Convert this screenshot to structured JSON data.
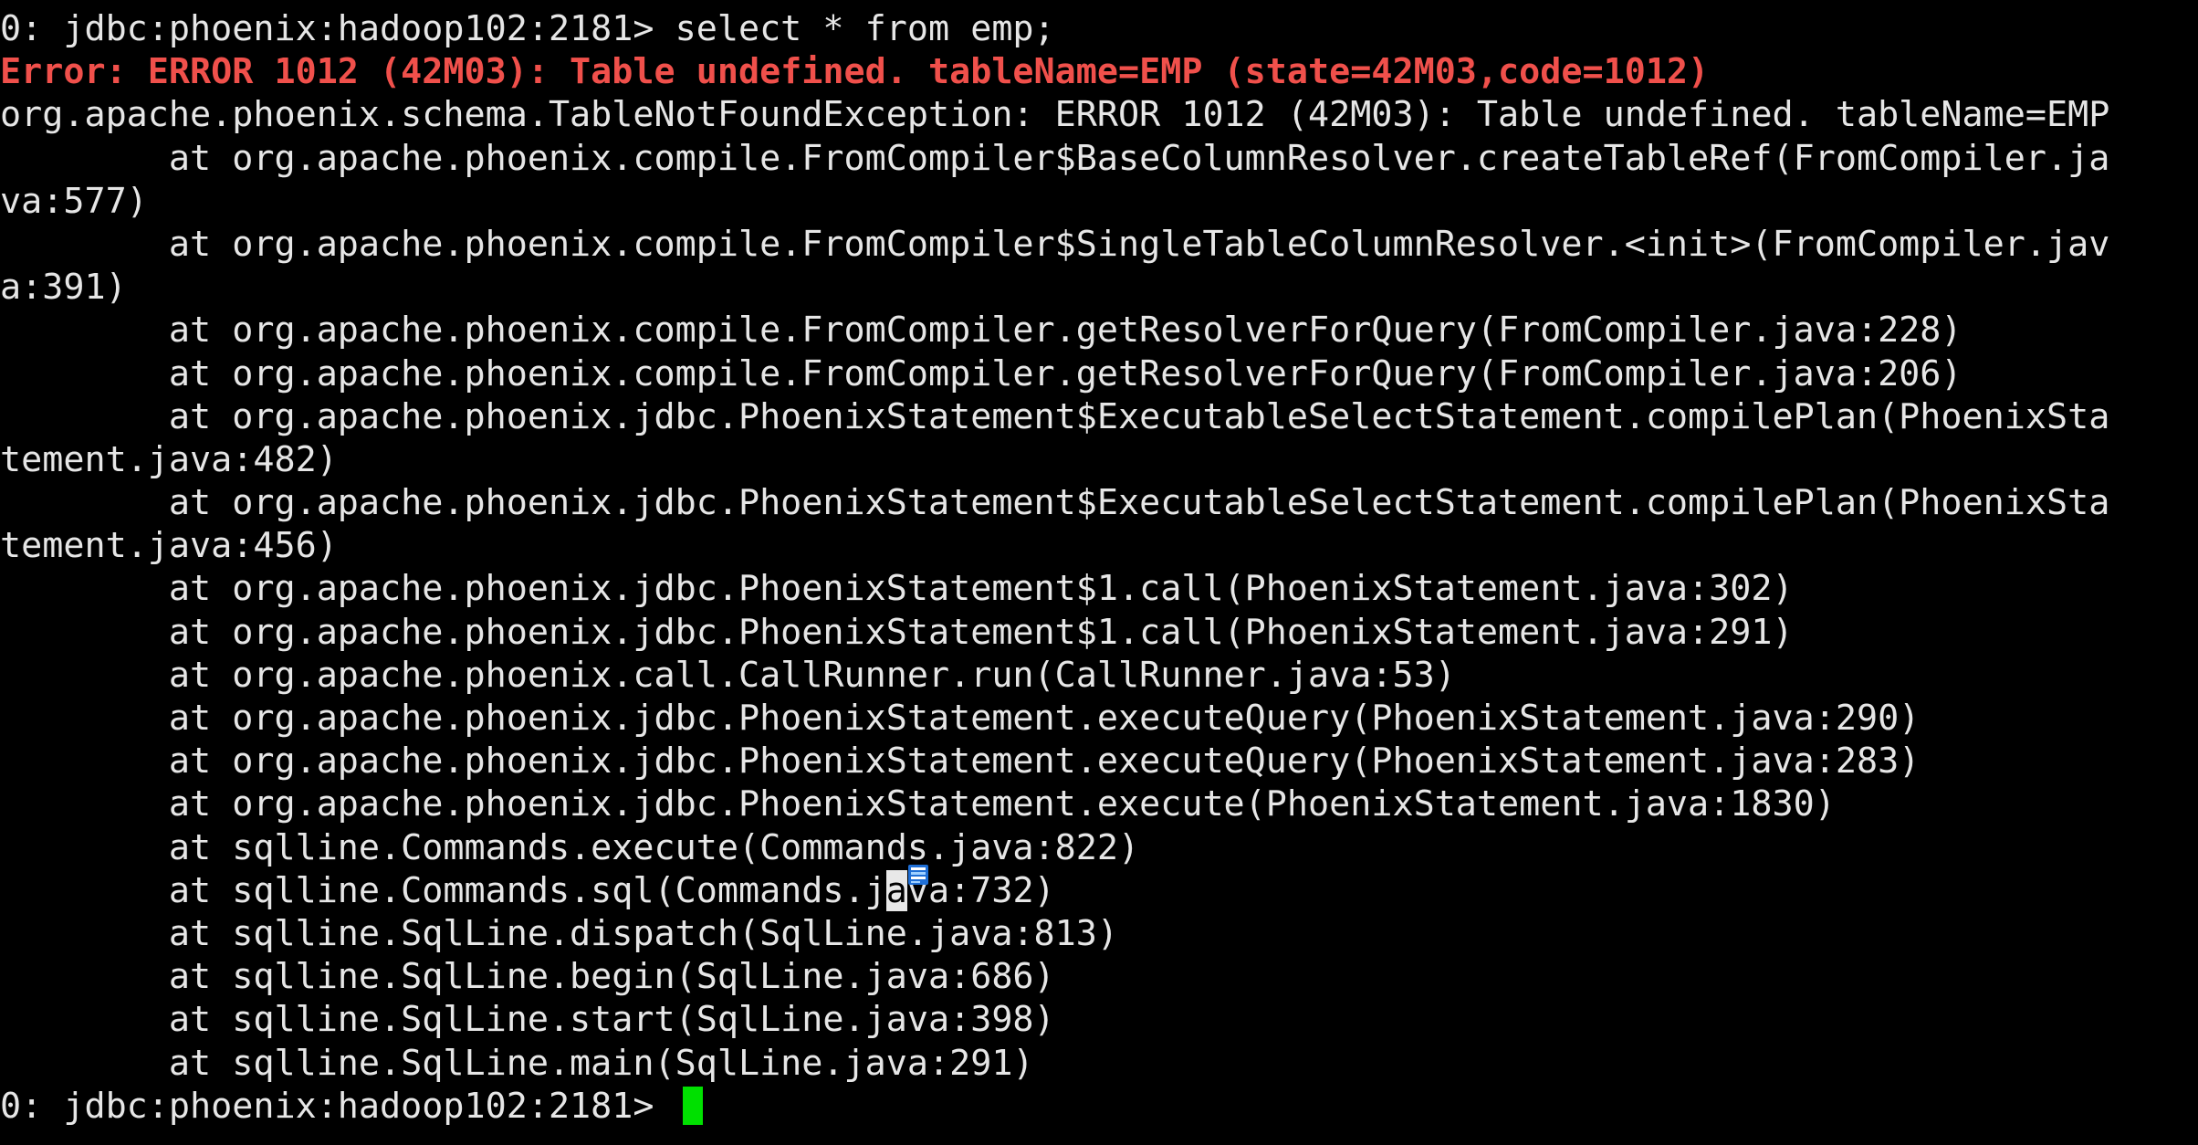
{
  "terminal": {
    "prompt_top": "0: jdbc:phoenix:hadoop102:2181> select * from emp;",
    "error_line": "Error: ERROR 1012 (42M03): Table undefined. tableName=EMP (state=42M03,code=1012)",
    "exception_line": "org.apache.phoenix.schema.TableNotFoundException: ERROR 1012 (42M03): Table undefined. tableName=EMP",
    "stack": [
      "        at org.apache.phoenix.compile.FromCompiler$BaseColumnResolver.createTableRef(FromCompiler.ja",
      "va:577)",
      "        at org.apache.phoenix.compile.FromCompiler$SingleTableColumnResolver.<init>(FromCompiler.jav",
      "a:391)",
      "        at org.apache.phoenix.compile.FromCompiler.getResolverForQuery(FromCompiler.java:228)",
      "        at org.apache.phoenix.compile.FromCompiler.getResolverForQuery(FromCompiler.java:206)",
      "        at org.apache.phoenix.jdbc.PhoenixStatement$ExecutableSelectStatement.compilePlan(PhoenixSta",
      "tement.java:482)",
      "        at org.apache.phoenix.jdbc.PhoenixStatement$ExecutableSelectStatement.compilePlan(PhoenixSta",
      "tement.java:456)",
      "        at org.apache.phoenix.jdbc.PhoenixStatement$1.call(PhoenixStatement.java:302)",
      "        at org.apache.phoenix.jdbc.PhoenixStatement$1.call(PhoenixStatement.java:291)",
      "        at org.apache.phoenix.call.CallRunner.run(CallRunner.java:53)",
      "        at org.apache.phoenix.jdbc.PhoenixStatement.executeQuery(PhoenixStatement.java:290)",
      "        at org.apache.phoenix.jdbc.PhoenixStatement.executeQuery(PhoenixStatement.java:283)",
      "        at org.apache.phoenix.jdbc.PhoenixStatement.execute(PhoenixStatement.java:1830)",
      "        at sqlline.Commands.execute(Commands.java:822)"
    ],
    "selected_line": {
      "before": "        at sqlline.Commands.sql(Commands.j",
      "selected": "a",
      "after": "va:732)"
    },
    "stack_tail": [
      "        at sqlline.SqlLine.dispatch(SqlLine.java:813)",
      "        at sqlline.SqlLine.begin(SqlLine.java:686)",
      "        at sqlline.SqlLine.start(SqlLine.java:398)",
      "        at sqlline.SqlLine.main(SqlLine.java:291)"
    ],
    "prompt_bottom": "0: jdbc:phoenix:hadoop102:2181> ",
    "colors": {
      "background": "#000000",
      "text": "#e6e6e6",
      "error": "#f0504b",
      "cursor": "#00e000"
    },
    "cursor_icon": "text-selection-cursor-icon"
  }
}
